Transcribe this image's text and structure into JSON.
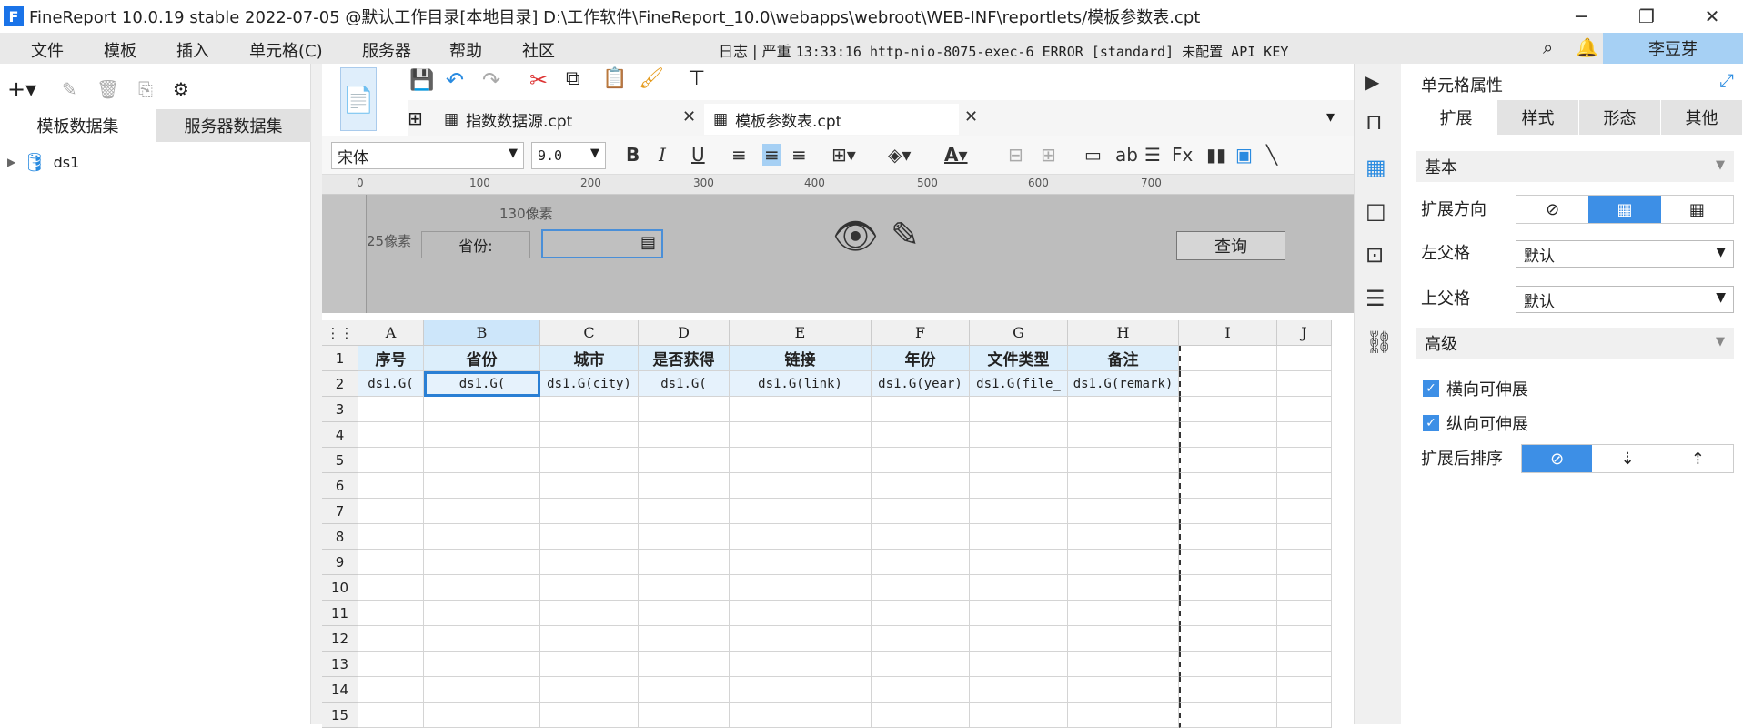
{
  "titlebar": {
    "title": "FineReport 10.0.19 stable 2022-07-05 @默认工作目录[本地目录]    D:\\工作软件\\FineReport_10.0\\webapps\\webroot\\WEB-INF\\reportlets/模板参数表.cpt"
  },
  "menu": {
    "items": [
      "文件",
      "模板",
      "插入",
      "单元格(C)",
      "服务器",
      "帮助",
      "社区"
    ],
    "log_label": "日志",
    "log_level": "严重",
    "log_message": "13:33:16 http-nio-8075-exec-6 ERROR [standard] 未配置 API KEY",
    "user": "李豆芽"
  },
  "left_pane": {
    "tabs": [
      "模板数据集",
      "服务器数据集"
    ],
    "tree": [
      {
        "label": "ds1"
      }
    ]
  },
  "tabs": {
    "items": [
      {
        "label": "指数数据源.cpt"
      },
      {
        "label": "模板参数表.cpt"
      }
    ]
  },
  "format_bar": {
    "font_name": "宋体",
    "font_size": "9.0"
  },
  "ruler": {
    "ticks": [
      "0",
      "100",
      "200",
      "300",
      "400",
      "500",
      "600",
      "700"
    ]
  },
  "param_pane": {
    "width_label": "130像素",
    "height_label": "25像素",
    "province_label": "省份:",
    "query_button": "查询"
  },
  "sheet": {
    "columns": [
      "A",
      "B",
      "C",
      "D",
      "E",
      "F",
      "G",
      "H",
      "I",
      "J"
    ],
    "rows": [
      "1",
      "2",
      "3",
      "4",
      "5",
      "6",
      "7",
      "8",
      "9",
      "10",
      "11",
      "12",
      "13",
      "14",
      "15"
    ],
    "header_row": [
      "序号",
      "省份",
      "城市",
      "是否获得",
      "链接",
      "年份",
      "文件类型",
      "备注"
    ],
    "data_row": [
      "ds1.G(",
      "ds1.G(",
      "ds1.G(city)",
      "ds1.G(",
      "ds1.G(link)",
      "ds1.G(year)",
      "ds1.G(file_",
      "ds1.G(remark)"
    ]
  },
  "right_pane": {
    "title": "单元格属性",
    "tabs": [
      "扩展",
      "样式",
      "形态",
      "其他"
    ],
    "section_basic": "基本",
    "expand_direction_label": "扩展方向",
    "left_parent_label": "左父格",
    "left_parent_value": "默认",
    "up_parent_label": "上父格",
    "up_parent_value": "默认",
    "section_advanced": "高级",
    "h_expand_label": "横向可伸展",
    "v_expand_label": "纵向可伸展",
    "sort_label": "扩展后排序"
  },
  "colors": {
    "accent": "#3d8fe6",
    "header_fill": "#dceefb",
    "param_bg": "#bdbdbd"
  }
}
